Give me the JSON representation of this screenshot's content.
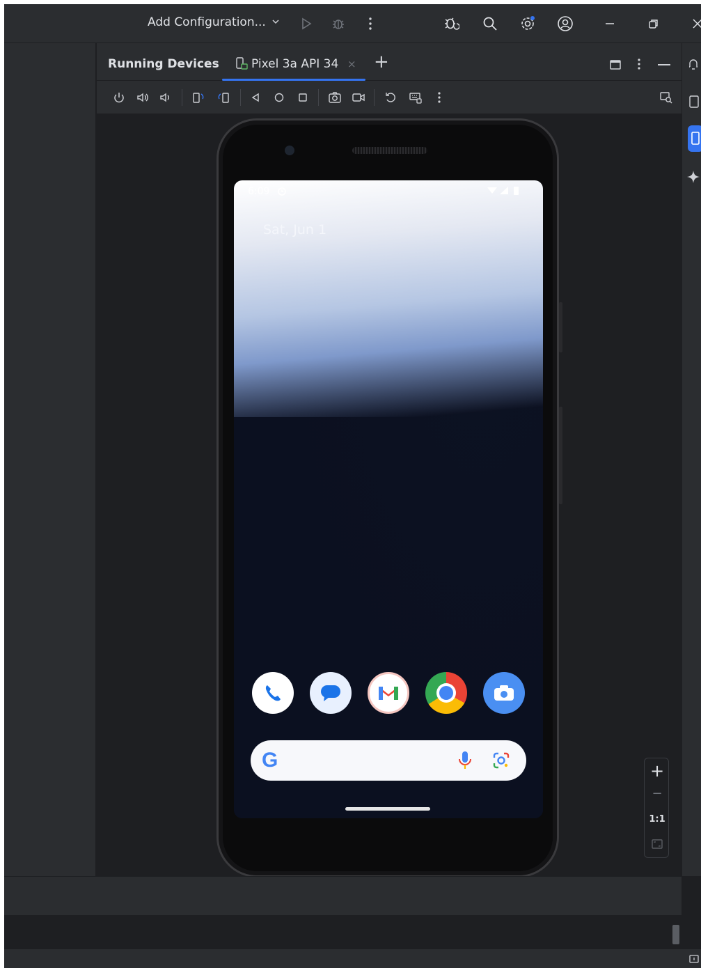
{
  "titlebar": {
    "config_label": "Add Configuration...",
    "icons": [
      "chevron-down-icon",
      "run-icon",
      "debug-icon",
      "more-vert-icon",
      "bug-sync-icon",
      "search-icon",
      "settings-icon",
      "account-icon",
      "minimize-icon",
      "restore-icon",
      "close-icon"
    ]
  },
  "panel": {
    "title": "Running Devices",
    "tab_label": "Pixel 3a API 34",
    "tab_close": "×",
    "add_tab": "+"
  },
  "toolbar": {
    "buttons": [
      "power",
      "volume-up",
      "volume-down",
      "rotate-left",
      "rotate-right",
      "back",
      "home",
      "overview",
      "screenshot",
      "screen-record",
      "reset",
      "keyboard",
      "more"
    ]
  },
  "phone": {
    "status_time": "6:09",
    "date": "Sat, Jun 1",
    "dock_apps": [
      "Phone",
      "Messages",
      "Gmail",
      "Chrome",
      "Camera"
    ],
    "search_logo": "G"
  },
  "zoom": {
    "plus": "+",
    "minus": "−",
    "ratio": "1:1"
  },
  "colors": {
    "accent": "#3574f0",
    "panel": "#2b2d30",
    "background": "#1e1f22"
  }
}
